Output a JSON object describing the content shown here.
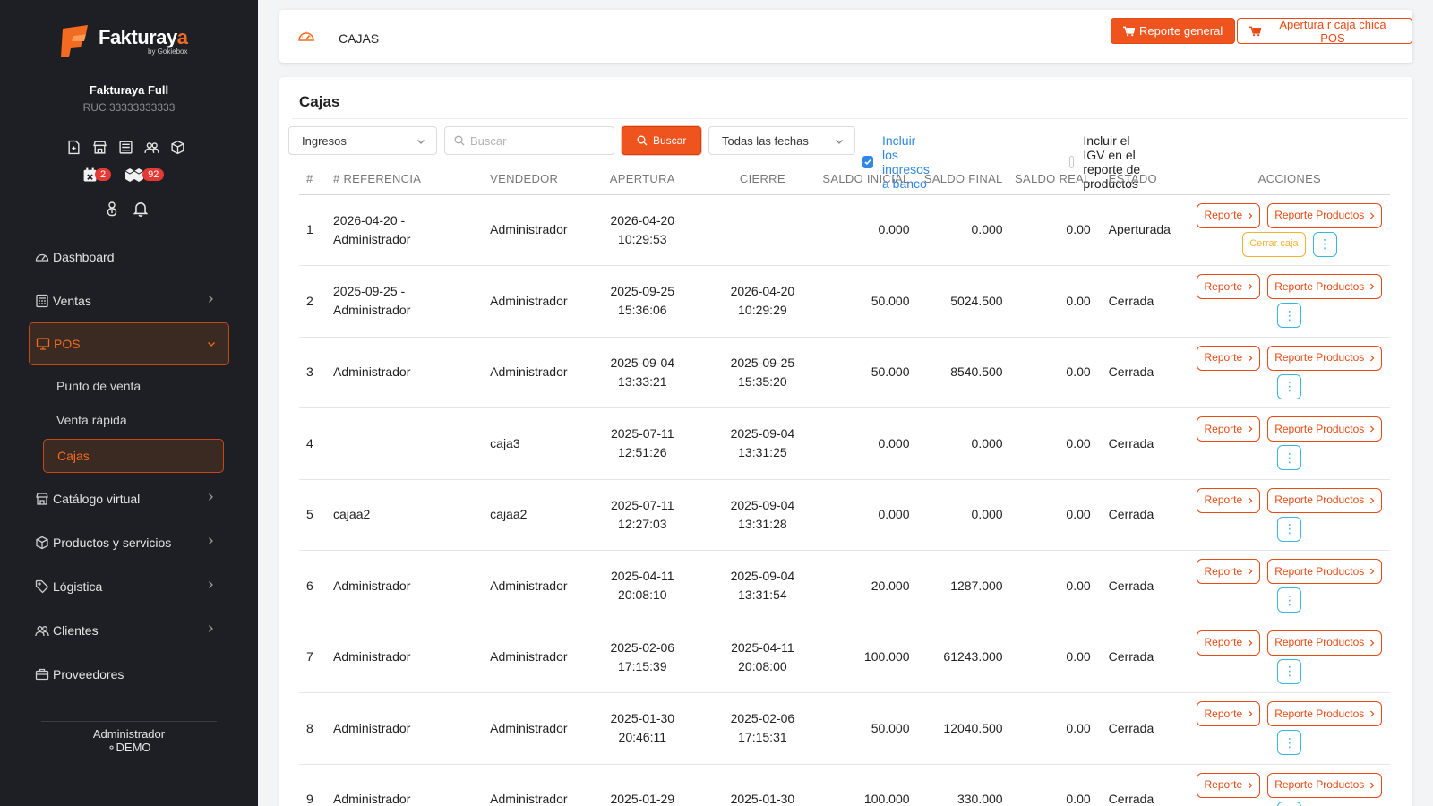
{
  "brand": {
    "name_part1": "Fakturay",
    "name_part2": "a",
    "sub": "by Gokiebox",
    "accent_color": "#f26b21"
  },
  "company": {
    "name": "Fakturaya Full",
    "ruc": "RUC 33333333333"
  },
  "sidebar": {
    "quick_icons": [
      "file-icon",
      "store-icon",
      "list-icon",
      "users-icon",
      "box-icon"
    ],
    "badges": {
      "calendar": "2",
      "boxes": "92"
    },
    "items": [
      {
        "label": "Dashboard",
        "icon": "gauge-icon"
      },
      {
        "label": "Ventas",
        "icon": "register-icon"
      },
      {
        "label": "POS",
        "icon": "monitor-icon"
      },
      {
        "label": "Catálogo virtual",
        "icon": "store-icon"
      },
      {
        "label": "Productos y servicios",
        "icon": "box-icon"
      },
      {
        "label": "Lógistica",
        "icon": "tag-icon"
      },
      {
        "label": "Clientes",
        "icon": "users-icon"
      },
      {
        "label": "Proveedores",
        "icon": "briefcase-icon"
      }
    ],
    "pos_sub": [
      "Punto de venta",
      "Venta rápida",
      "Cajas"
    ],
    "footer_user": "Administrador",
    "footer_mode": "DEMO"
  },
  "topbar": {
    "title": "CAJAS",
    "btn_report": "Reporte general",
    "btn_open": "Apertura r caja chica POS"
  },
  "main": {
    "title": "Cajas",
    "filter_type": "Ingresos",
    "search_placeholder": "Buscar",
    "search_button": "Buscar",
    "filter_dates": "Todas las fechas",
    "chk_bank": "Incluir los ingresos a banco",
    "chk_igv": "Incluir el IGV en el reporte de productos",
    "columns": [
      "#",
      "# REFERENCIA",
      "VENDEDOR",
      "APERTURA",
      "CIERRE",
      "SALDO INICIAL",
      "SALDO FINAL",
      "SALDO REAL",
      "ESTADO",
      "ACCIONES"
    ],
    "action_labels": {
      "report": "Reporte",
      "report_products": "Reporte Productos",
      "close": "Cerrar caja"
    },
    "rows": [
      {
        "num": "1",
        "ref1": "2026-04-20 -",
        "ref2": "Administrador",
        "vendor": "Administrador",
        "open_d": "2026-04-20",
        "open_t": "10:29:53",
        "close_d": "",
        "close_t": "",
        "init": "0.000",
        "final": "0.000",
        "real": "0.00",
        "state": "Aperturada"
      },
      {
        "num": "2",
        "ref1": "2025-09-25 -",
        "ref2": "Administrador",
        "vendor": "Administrador",
        "open_d": "2025-09-25",
        "open_t": "15:36:06",
        "close_d": "2026-04-20",
        "close_t": "10:29:29",
        "init": "50.000",
        "final": "5024.500",
        "real": "0.00",
        "state": "Cerrada"
      },
      {
        "num": "3",
        "ref1": "Administrador",
        "ref2": "",
        "vendor": "Administrador",
        "open_d": "2025-09-04",
        "open_t": "13:33:21",
        "close_d": "2025-09-25",
        "close_t": "15:35:20",
        "init": "50.000",
        "final": "8540.500",
        "real": "0.00",
        "state": "Cerrada"
      },
      {
        "num": "4",
        "ref1": "",
        "ref2": "",
        "vendor": "caja3",
        "open_d": "2025-07-11",
        "open_t": "12:51:26",
        "close_d": "2025-09-04",
        "close_t": "13:31:25",
        "init": "0.000",
        "final": "0.000",
        "real": "0.00",
        "state": "Cerrada"
      },
      {
        "num": "5",
        "ref1": "cajaa2",
        "ref2": "",
        "vendor": "cajaa2",
        "open_d": "2025-07-11",
        "open_t": "12:27:03",
        "close_d": "2025-09-04",
        "close_t": "13:31:28",
        "init": "0.000",
        "final": "0.000",
        "real": "0.00",
        "state": "Cerrada"
      },
      {
        "num": "6",
        "ref1": "Administrador",
        "ref2": "",
        "vendor": "Administrador",
        "open_d": "2025-04-11",
        "open_t": "20:08:10",
        "close_d": "2025-09-04",
        "close_t": "13:31:54",
        "init": "20.000",
        "final": "1287.000",
        "real": "0.00",
        "state": "Cerrada"
      },
      {
        "num": "7",
        "ref1": "Administrador",
        "ref2": "",
        "vendor": "Administrador",
        "open_d": "2025-02-06",
        "open_t": "17:15:39",
        "close_d": "2025-04-11",
        "close_t": "20:08:00",
        "init": "100.000",
        "final": "61243.000",
        "real": "0.00",
        "state": "Cerrada"
      },
      {
        "num": "8",
        "ref1": "Administrador",
        "ref2": "",
        "vendor": "Administrador",
        "open_d": "2025-01-30",
        "open_t": "20:46:11",
        "close_d": "2025-02-06",
        "close_t": "17:15:31",
        "init": "50.000",
        "final": "12040.500",
        "real": "0.00",
        "state": "Cerrada"
      },
      {
        "num": "9",
        "ref1": "Administrador",
        "ref2": "",
        "vendor": "Administrador",
        "open_d": "2025-01-29",
        "open_t": "",
        "close_d": "2025-01-30",
        "close_t": "",
        "init": "100.000",
        "final": "330.000",
        "real": "0.00",
        "state": "Cerrada"
      }
    ]
  }
}
